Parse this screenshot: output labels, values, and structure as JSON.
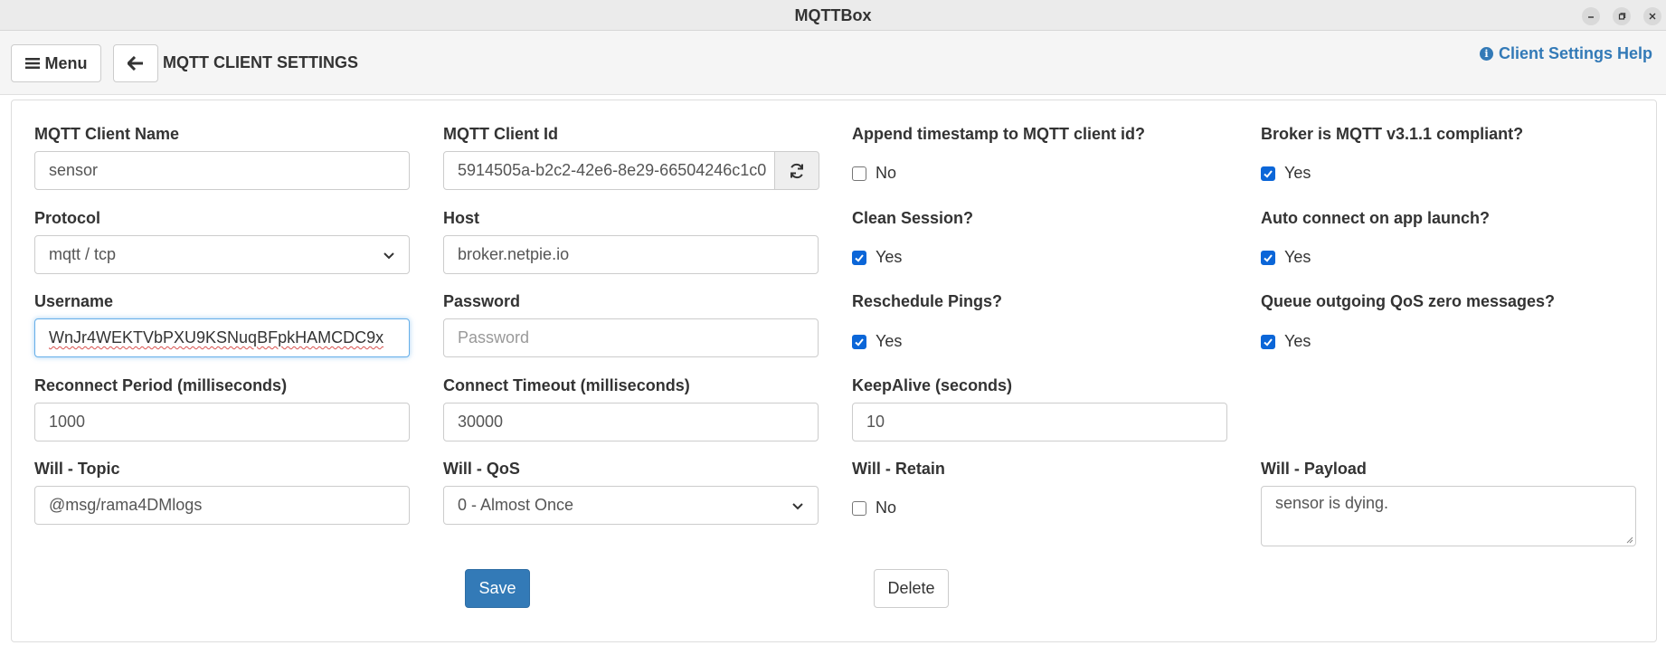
{
  "window": {
    "title": "MQTTBox"
  },
  "toolbar": {
    "menu_label": "Menu",
    "page_title": "MQTT CLIENT SETTINGS",
    "help_label": "Client Settings Help"
  },
  "form": {
    "client_name": {
      "label": "MQTT Client Name",
      "value": "sensor"
    },
    "client_id": {
      "label": "MQTT Client Id",
      "value": "5914505a-b2c2-42e6-8e29-66504246c1c0"
    },
    "append_timestamp": {
      "label": "Append timestamp to MQTT client id?",
      "checked": false,
      "text": "No"
    },
    "broker_compliant": {
      "label": "Broker is MQTT v3.1.1 compliant?",
      "checked": true,
      "text": "Yes"
    },
    "protocol": {
      "label": "Protocol",
      "value": "mqtt / tcp"
    },
    "host": {
      "label": "Host",
      "value": "broker.netpie.io"
    },
    "clean_session": {
      "label": "Clean Session?",
      "checked": true,
      "text": "Yes"
    },
    "auto_connect": {
      "label": "Auto connect on app launch?",
      "checked": true,
      "text": "Yes"
    },
    "username": {
      "label": "Username",
      "value": "WnJr4WEKTVbPXU9KSNuqBFpkHAMCDC9x"
    },
    "password": {
      "label": "Password",
      "placeholder": "Password"
    },
    "reschedule_pings": {
      "label": "Reschedule Pings?",
      "checked": true,
      "text": "Yes"
    },
    "queue_qos_zero": {
      "label": "Queue outgoing QoS zero messages?",
      "checked": true,
      "text": "Yes"
    },
    "reconnect_period": {
      "label": "Reconnect Period (milliseconds)",
      "value": "1000"
    },
    "connect_timeout": {
      "label": "Connect Timeout (milliseconds)",
      "value": "30000"
    },
    "keepalive": {
      "label": "KeepAlive (seconds)",
      "value": "10"
    },
    "will_topic": {
      "label": "Will - Topic",
      "value": "@msg/rama4DMlogs"
    },
    "will_qos": {
      "label": "Will - QoS",
      "value": "0 - Almost Once"
    },
    "will_retain": {
      "label": "Will - Retain",
      "checked": false,
      "text": "No"
    },
    "will_payload": {
      "label": "Will - Payload",
      "value": "sensor is dying."
    }
  },
  "actions": {
    "save_label": "Save",
    "delete_label": "Delete"
  },
  "colors": {
    "accent": "#337ab7",
    "checkbox": "#0b66d8"
  }
}
